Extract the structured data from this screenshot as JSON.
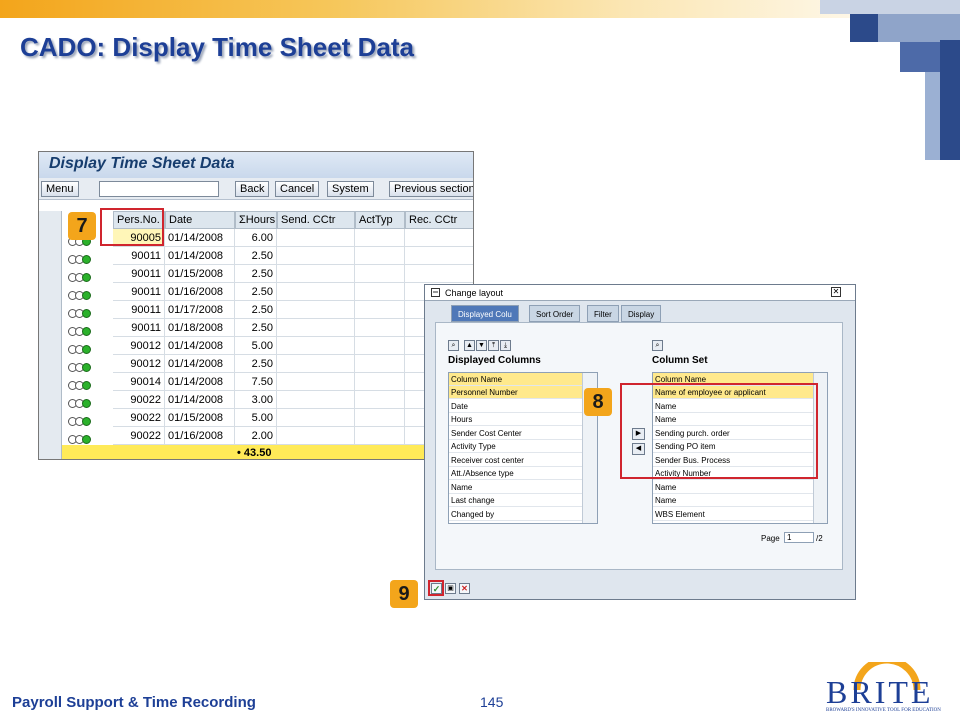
{
  "slide": {
    "title": "CADO: Display Time Sheet Data",
    "footer": "Payroll Support & Time Recording",
    "page_number": "145",
    "logo_text": "BRITE",
    "logo_sub": "BROWARD'S INNOVATIVE TOOL FOR EDUCATION",
    "callouts": [
      "7",
      "8",
      "9"
    ],
    "colors": {
      "title": "#1d3f96",
      "callout": "#f3a51b",
      "highlight": "#d0252e"
    }
  },
  "window1": {
    "title": "Display Time Sheet Data",
    "toolbar": {
      "menu": "Menu",
      "back": "Back",
      "cancel": "Cancel",
      "system": "System",
      "previous": "Previous section"
    },
    "columns": [
      "Pers.No.",
      "Date",
      "ΣHours",
      "Send. CCtr",
      "ActTyp",
      "Rec. CCtr"
    ],
    "rows": [
      {
        "pers": "90005",
        "date": "01/14/2008",
        "hours": "6.00"
      },
      {
        "pers": "90011",
        "date": "01/14/2008",
        "hours": "2.50"
      },
      {
        "pers": "90011",
        "date": "01/15/2008",
        "hours": "2.50"
      },
      {
        "pers": "90011",
        "date": "01/16/2008",
        "hours": "2.50"
      },
      {
        "pers": "90011",
        "date": "01/17/2008",
        "hours": "2.50"
      },
      {
        "pers": "90011",
        "date": "01/18/2008",
        "hours": "2.50"
      },
      {
        "pers": "90012",
        "date": "01/14/2008",
        "hours": "5.00"
      },
      {
        "pers": "90012",
        "date": "01/14/2008",
        "hours": "2.50"
      },
      {
        "pers": "90014",
        "date": "01/14/2008",
        "hours": "7.50"
      },
      {
        "pers": "90022",
        "date": "01/14/2008",
        "hours": "3.00"
      },
      {
        "pers": "90022",
        "date": "01/15/2008",
        "hours": "5.00"
      },
      {
        "pers": "90022",
        "date": "01/16/2008",
        "hours": "2.00"
      }
    ],
    "total": "• 43.50"
  },
  "window2": {
    "title": "Change layout",
    "tabs": [
      "Displayed Colu",
      "Sort Order",
      "Filter",
      "Display"
    ],
    "displayed_title": "Displayed Columns",
    "displayed_header": "Column Name",
    "displayed": [
      "Personnel Number",
      "Date",
      "Hours",
      "Sender Cost Center",
      "Activity Type",
      "Receiver cost center",
      "Att./Absence type",
      "Name",
      "Last change",
      "Changed by"
    ],
    "set_title": "Column Set",
    "set_header": "Column Name",
    "column_set": [
      "Name of employee or applicant",
      "Name",
      "Name",
      "Sending purch. order",
      "Sending PO item",
      "Sender Bus. Process",
      "Activity Number",
      "Name",
      "Name",
      "WBS Element"
    ],
    "page_label": "Page",
    "page_value": "1",
    "page_total": "/2"
  }
}
